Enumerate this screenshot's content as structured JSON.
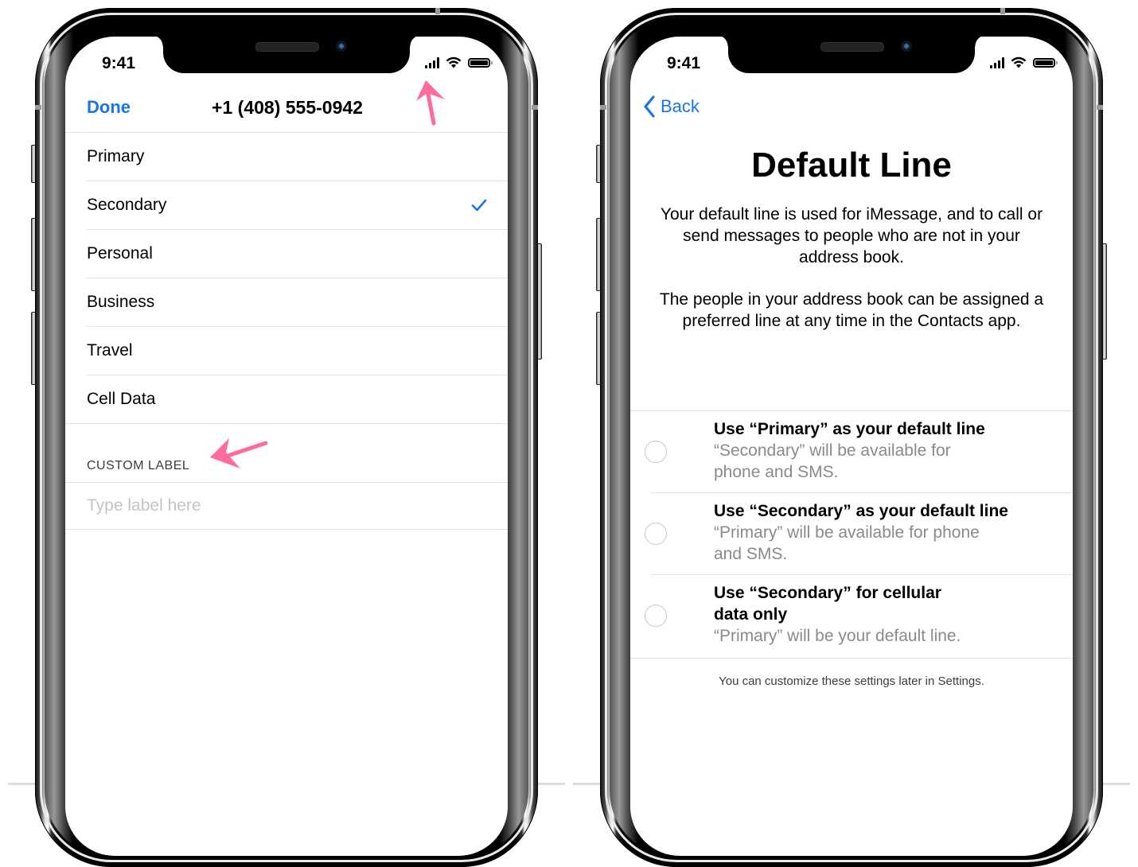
{
  "colors": {
    "accent": "#1a73e8",
    "annotation_arrow": "#ff6b9a",
    "secondary_text": "#8a8a8e",
    "separator": "#e3e3e6",
    "placeholder": "#c4c4c7"
  },
  "left_phone": {
    "status_bar": {
      "time": "9:41",
      "icons": [
        "dual-sim-signal-icon",
        "wifi-icon",
        "battery-icon"
      ]
    },
    "nav": {
      "done_label": "Done",
      "title": "+1 (408) 555-0942"
    },
    "labels": [
      {
        "label": "Primary",
        "selected": false
      },
      {
        "label": "Secondary",
        "selected": true
      },
      {
        "label": "Personal",
        "selected": false
      },
      {
        "label": "Business",
        "selected": false
      },
      {
        "label": "Travel",
        "selected": false
      },
      {
        "label": "Cell Data",
        "selected": false
      }
    ],
    "custom_section": {
      "header": "CUSTOM LABEL",
      "input_value": "",
      "input_placeholder": "Type label here"
    },
    "annotations": [
      "arrow-pointing-to-signal-icon",
      "arrow-pointing-to-custom-label"
    ]
  },
  "right_phone": {
    "status_bar": {
      "time": "9:41",
      "icons": [
        "dual-sim-signal-icon",
        "wifi-icon",
        "battery-icon"
      ]
    },
    "nav": {
      "back_label": "Back"
    },
    "title": "Default Line",
    "paragraphs": [
      "Your default line is used for iMessage, and to call or send messages to people who are not in your address book.",
      "The people in your address book can be assigned a preferred line at any time in the Contacts app."
    ],
    "options": [
      {
        "title": "Use “Primary” as your default line",
        "subtitle": "“Secondary” will be available for phone and SMS.",
        "selected": false
      },
      {
        "title": "Use “Secondary” as your default line",
        "subtitle": "“Primary” will be available for phone and SMS.",
        "selected": false
      },
      {
        "title": "Use “Secondary” for cellular data only",
        "subtitle": "“Primary” will be your default line.",
        "selected": false
      }
    ],
    "footnote": "You can customize these settings later in Settings."
  }
}
